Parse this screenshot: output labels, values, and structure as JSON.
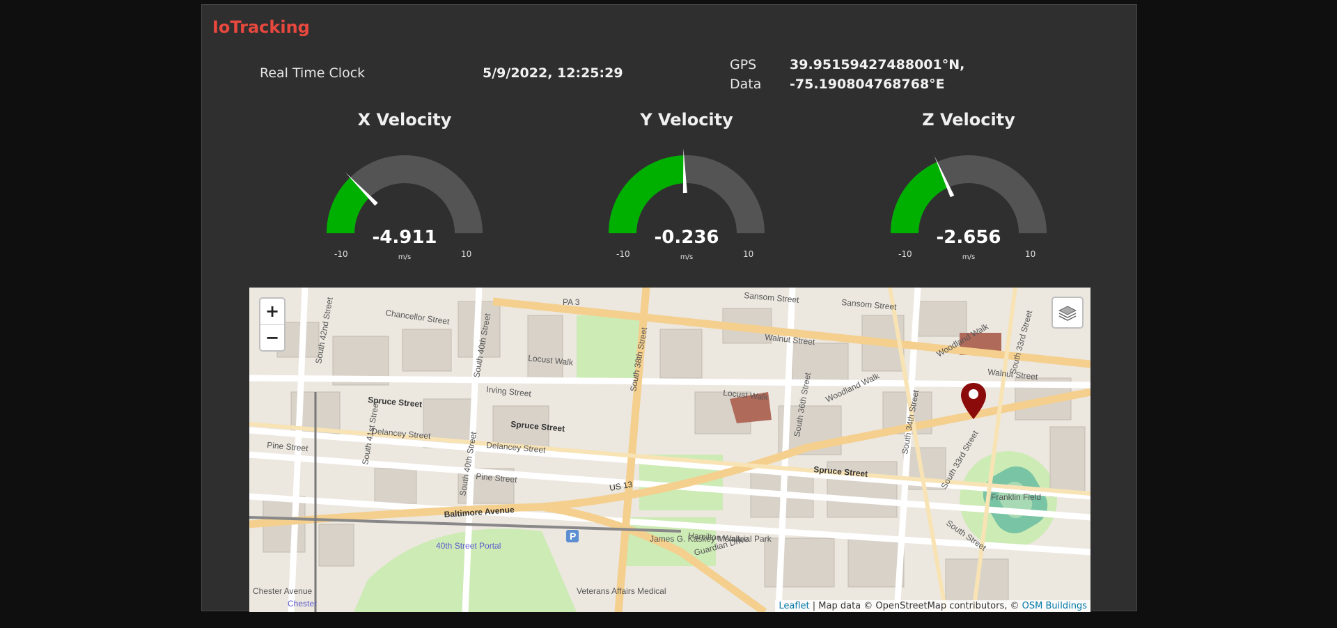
{
  "app": {
    "title": "IoTracking"
  },
  "clock": {
    "label": "Real Time Clock",
    "value": "5/9/2022, 12:25:29"
  },
  "gps": {
    "label_line1": "GPS",
    "label_line2": "Data",
    "lat": "39.95159427488001°N,",
    "lon": "-75.190804768768°E"
  },
  "gauges": [
    {
      "title": "X Velocity",
      "reading": "-4.911",
      "value": -4.911,
      "min": "-10",
      "max": "10",
      "unit": "m/s"
    },
    {
      "title": "Y Velocity",
      "reading": "-0.236",
      "value": -0.236,
      "min": "-10",
      "max": "10",
      "unit": "m/s"
    },
    {
      "title": "Z Velocity",
      "reading": "-2.656",
      "value": -2.656,
      "min": "-10",
      "max": "10",
      "unit": "m/s"
    }
  ],
  "gauge_colors": {
    "fill": "#00b000",
    "track": "#545454",
    "needle": "#ffffff"
  },
  "map": {
    "zoom_in": "+",
    "zoom_out": "−",
    "layers_icon": "layers-icon",
    "marker_icon": "map-marker-icon",
    "marker_color": "#8b0a0a",
    "attribution": {
      "leaflet": "Leaflet",
      "middle": " | Map data © OpenStreetMap contributors, © ",
      "osm_buildings": "OSM Buildings"
    },
    "labels": {
      "pa3": "PA 3",
      "chancellor": "Chancellor Street",
      "sansom1": "Sansom Street",
      "sansom2": "Sansom Street",
      "walnut1": "Walnut Street",
      "walnut2": "Walnut Street",
      "woodland": "Woodland Walk",
      "woodland2": "Woodland Walk",
      "locust1": "Locust Walk",
      "locust2": "Locust Walk",
      "irving": "Irving Street",
      "spruce1": "Spruce Street",
      "spruce2": "Spruce Street",
      "spruce3": "Spruce Street",
      "delancey1": "Delancey Street",
      "delancey2": "Delancey Street",
      "pine1": "Pine Street",
      "pine2": "Pine Street",
      "baltimore": "Baltimore Avenue",
      "us13": "US 13",
      "hamilton": "Hamilton Walk",
      "guardian": "Guardian Drive",
      "s38": "South 38th Street",
      "s36": "South 36th Street",
      "s34": "South 34th Street",
      "s33": "South 33rd Street",
      "s33b": "South 33rd Street",
      "s40": "South 40th Street",
      "s41": "South 41st Street",
      "s42": "South 42nd Street",
      "s40b": "South 40th Street",
      "park": "James G. Kaskey Memorial Park",
      "field": "Franklin Field",
      "portal": "40th Street Portal",
      "veterans": "Veterans Affairs Medical",
      "chester": "Chester Avenue",
      "chester2": "Chester",
      "south_street": "South Street",
      "parking": "P"
    }
  }
}
